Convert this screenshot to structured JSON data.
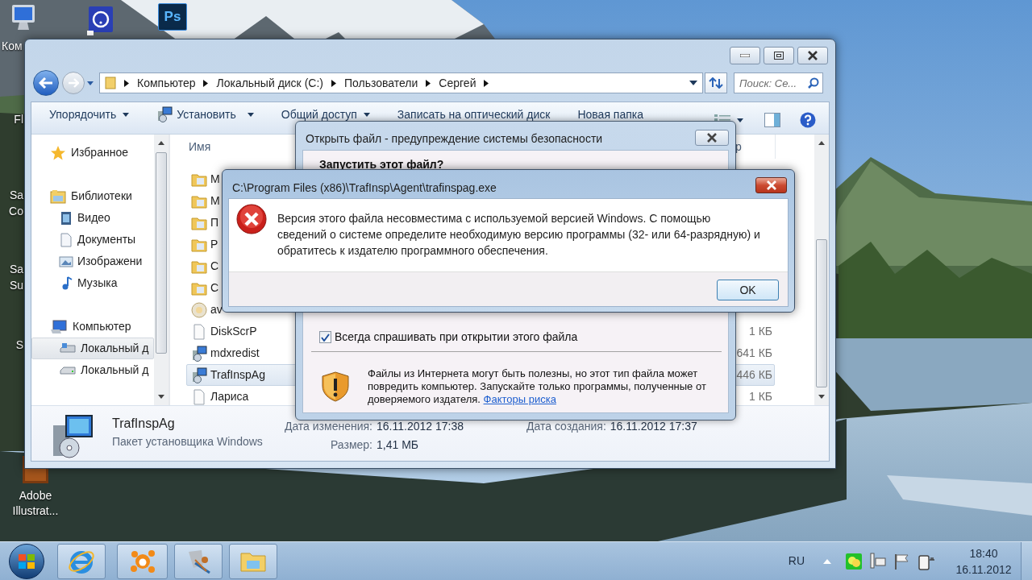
{
  "desktop_icons": [
    {
      "kind": "computer",
      "label": [
        "Ком"
      ]
    },
    {
      "kind": "help"
    },
    {
      "kind": "photoshop",
      "glyph": "Ps"
    },
    {
      "kind": "hidden",
      "label": [
        "Fl"
      ]
    },
    {
      "kind": "hidden",
      "label": [
        "Sa",
        "Co"
      ]
    },
    {
      "kind": "hidden",
      "label": [
        "Sa",
        "Su"
      ]
    },
    {
      "kind": "hidden",
      "label": [
        "S"
      ]
    },
    {
      "kind": "illustrator",
      "label": [
        "Adobe",
        "Illustrat..."
      ]
    }
  ],
  "explorer": {
    "breadcrumb": [
      "Компьютер",
      "Локальный диск (C:)",
      "Пользователи",
      "Сергей"
    ],
    "search_placeholder": "Поиск: Се...",
    "toolbar": [
      {
        "label": "Упорядочить",
        "kind": "menu"
      },
      {
        "label": "Установить",
        "kind": "install_menu"
      },
      {
        "label": "Общий доступ",
        "kind": "menu"
      },
      {
        "label": "Записать на оптический диск",
        "kind": "command"
      },
      {
        "label": "Новая папка",
        "kind": "command"
      }
    ],
    "nav": [
      {
        "label": "Избранное",
        "selected": false
      },
      {
        "label": "Библиотеки",
        "selected": false,
        "children": [
          {
            "label": "Видео",
            "selected": false
          },
          {
            "label": "Документы",
            "selected": false
          },
          {
            "label": "Изображени",
            "selected": false
          },
          {
            "label": "Музыка",
            "selected": false
          }
        ]
      },
      {
        "label": "Компьютер",
        "selected": false,
        "children": [
          {
            "label": "Локальный д",
            "selected": true
          },
          {
            "label": "Локальный д",
            "selected": false
          }
        ]
      }
    ],
    "columns": [
      "Имя",
      "р"
    ],
    "files": [
      {
        "name": "М",
        "kind": "folder",
        "selected": false
      },
      {
        "name": "М",
        "kind": "folder",
        "selected": false
      },
      {
        "name": "П",
        "kind": "folder",
        "selected": false
      },
      {
        "name": "Р",
        "kind": "folder",
        "selected": false
      },
      {
        "name": "С",
        "kind": "folder",
        "selected": false
      },
      {
        "name": "С",
        "kind": "folder",
        "selected": false
      },
      {
        "name": "av",
        "kind": "app",
        "selected": false
      },
      {
        "name": "DiskScrP",
        "kind": "file",
        "size": "1 КБ",
        "selected": false
      },
      {
        "name": "mdxredist",
        "kind": "installer",
        "size": "641 КБ",
        "selected": false
      },
      {
        "name": "TrafInspAg",
        "kind": "installer",
        "size": "446 КБ",
        "selected": true
      },
      {
        "name": "Лариса",
        "kind": "file",
        "size": "1 КБ",
        "selected": false
      }
    ],
    "details": {
      "name": "TrafInspAg",
      "type": "Пакет установщика Windows",
      "fields": [
        {
          "label": "Дата изменения:",
          "value": "16.11.2012 17:38"
        },
        {
          "label": "Размер:",
          "value": "1,41 МБ"
        },
        {
          "label": "Дата создания:",
          "value": "16.11.2012 17:37"
        }
      ]
    }
  },
  "security_dialog": {
    "title": "Открыть файл - предупреждение системы безопасности",
    "heading": "Запустить этот файл?",
    "checkbox": {
      "label": "Всегда спрашивать при открытии этого файла",
      "checked": true
    },
    "warning": "Файлы из Интернета могут быть полезны, но этот тип файла может повредить компьютер. Запускайте только программы, полученные от доверяемого издателя.",
    "link": "Факторы риска"
  },
  "error_dialog": {
    "title": "C:\\Program Files (x86)\\TrafInsp\\Agent\\trafinspag.exe",
    "message": "Версия этого файла несовместима с используемой версией Windows. С помощью сведений о системе определите необходимую версию программы (32- или 64-разрядную) и обратитесь к издателю программного обеспечения.",
    "button": "OK"
  },
  "taskbar": {
    "apps": [
      {
        "kind": "browser"
      },
      {
        "kind": "antivirus"
      },
      {
        "kind": "tools"
      },
      {
        "kind": "explorer"
      }
    ],
    "language": "RU",
    "time": "18:40",
    "date": "16.11.2012"
  }
}
